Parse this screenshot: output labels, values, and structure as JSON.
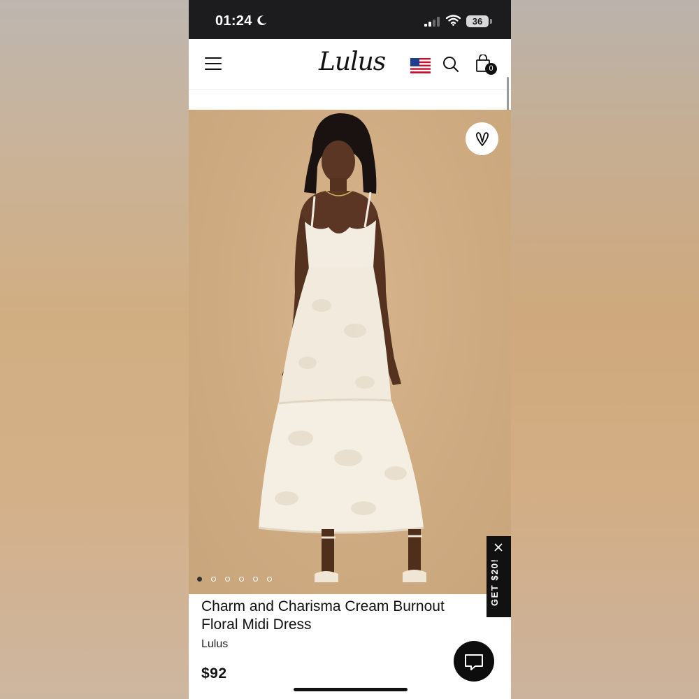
{
  "status_bar": {
    "time": "01:24",
    "battery": "36",
    "icons": [
      "moon-icon",
      "signal-icon",
      "wifi-icon",
      "battery-icon"
    ]
  },
  "header": {
    "logo": "Lulus",
    "icons": [
      "menu-icon",
      "us-flag-icon",
      "search-icon",
      "shopping-bag-icon"
    ],
    "bag_count": "0"
  },
  "product": {
    "title": "Charm and Charisma Cream Burnout Floral Midi Dress",
    "brand": "Lulus",
    "price": "$92",
    "image_count": 6,
    "active_image": 1
  },
  "promo": {
    "label": "GET $20!"
  },
  "chat": {
    "icon": "chat-icon"
  },
  "colors": {
    "status_bar": "#1c1c1e",
    "photo_background": "#d2ae85",
    "dress": "#f3ece0",
    "accent": "#111111"
  }
}
